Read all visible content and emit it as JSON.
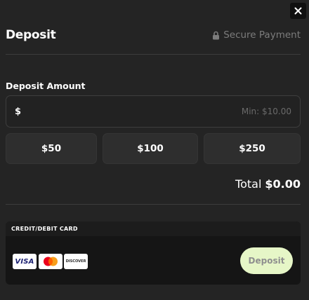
{
  "header": {
    "title": "Deposit",
    "secure_label": "Secure Payment",
    "lock_icon": "lock-icon",
    "close_icon": "close-icon"
  },
  "amount": {
    "label": "Deposit Amount",
    "currency_symbol": "$",
    "value": "",
    "placeholder": "Min: $10.00"
  },
  "quick_amounts": [
    "$50",
    "$100",
    "$250"
  ],
  "total": {
    "label": "Total",
    "value": "$0.00"
  },
  "payment_method": {
    "title": "CREDIT/DEBIT CARD",
    "brands": [
      {
        "icon": "visa-icon",
        "text": "VISA"
      },
      {
        "icon": "mastercard-icon"
      },
      {
        "icon": "discover-icon",
        "text": "DISCOVER"
      }
    ],
    "submit_label": "Deposit"
  },
  "colors": {
    "background": "#242424",
    "panel": "#151515",
    "submit_button": "#e6f6c7",
    "secure_text": "#7c7c7c"
  }
}
